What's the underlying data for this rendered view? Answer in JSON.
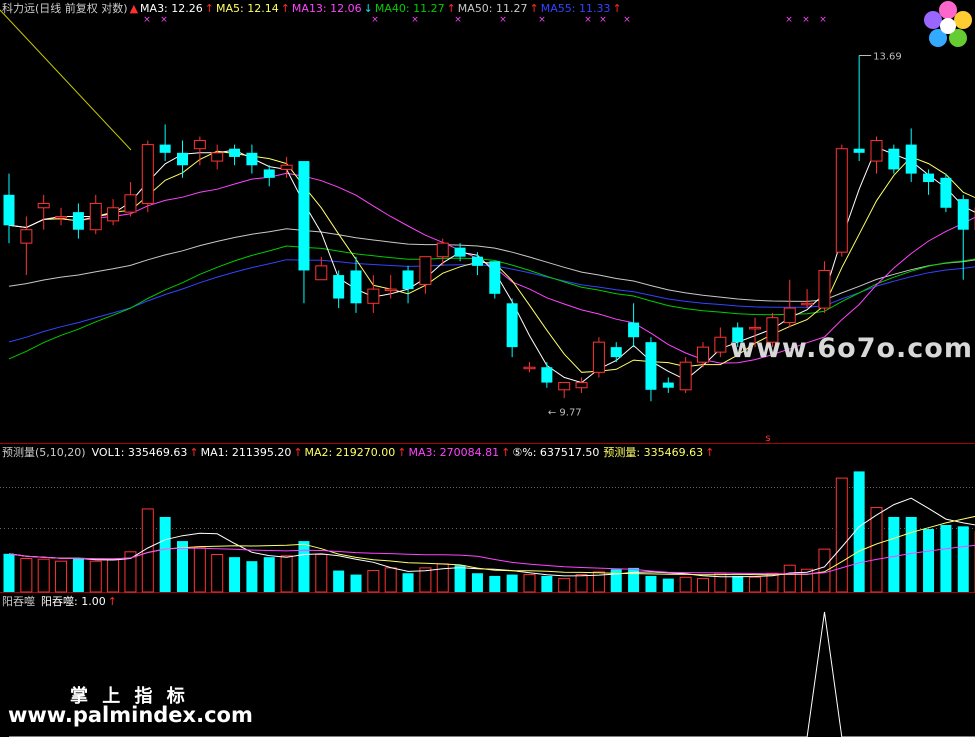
{
  "colors": {
    "up": "#ff3333",
    "down": "#00ffff",
    "ma3": "#ffffff",
    "ma5": "#ffff66",
    "ma13": "#ff44ff",
    "ma40": "#00cc00",
    "ma50": "#c8c8c8",
    "ma55": "#3344ff",
    "sep": "#aa0000",
    "signal": "#ffffff",
    "dotted": "#666666"
  },
  "price_header": {
    "title": "科力远(日线 前复权 对数)",
    "items": [
      {
        "label": "MA3: 12.26",
        "color": "#ffffff",
        "arrow": "↑",
        "dir": "up"
      },
      {
        "label": "MA5: 12.14",
        "color": "#ffff66",
        "arrow": "↑",
        "dir": "up"
      },
      {
        "label": "MA13: 12.06",
        "color": "#ff44ff",
        "arrow": "↓",
        "dir": "down"
      },
      {
        "label": "MA40: 11.27",
        "color": "#00cc00",
        "arrow": "↑",
        "dir": "up"
      },
      {
        "label": "MA50: 11.27",
        "color": "#c8c8c8",
        "arrow": "↑",
        "dir": "up"
      },
      {
        "label": "MA55: 11.33",
        "color": "#3344ff",
        "arrow": "↑",
        "dir": "up"
      }
    ]
  },
  "volume_header": {
    "title": "预测量(5,10,20)",
    "items": [
      {
        "label": "VOL1: 335469.63",
        "color": "#ffffff",
        "arrow": "↑"
      },
      {
        "label": "MA1: 211395.20",
        "color": "#ffffff",
        "arrow": "↑"
      },
      {
        "label": "MA2: 219270.00",
        "color": "#ffff66",
        "arrow": "↑"
      },
      {
        "label": "MA3: 270084.81",
        "color": "#ff44ff",
        "arrow": "↑"
      },
      {
        "label": "⑤%: 637517.50",
        "color": "#ffffff",
        "arrow": ""
      },
      {
        "label": "预测量: 335469.63",
        "color": "#ffff66",
        "arrow": "↑"
      }
    ]
  },
  "signal_header": {
    "title": "阳吞噬",
    "item": "阳吞噬: 1.00",
    "arrow": "↑"
  },
  "annotations": {
    "high": "13.69",
    "low": "← 9.77",
    "marker": "s"
  },
  "watermarks": {
    "site1": "www.6o7o.com",
    "cn": "掌 上 指 标",
    "site2": "www.palmindex.com"
  },
  "icons": {
    "logo": "flower-logo-icon"
  },
  "chart_data": {
    "type": "candlestick",
    "price_ylim": [
      9.5,
      14.2
    ],
    "volume_ylim": [
      0,
      1000000
    ],
    "candles": [
      [
        11.95,
        11.6,
        12.2,
        11.4,
        285000
      ],
      [
        11.4,
        11.55,
        11.7,
        11.05,
        250000
      ],
      [
        11.8,
        11.85,
        11.95,
        11.55,
        245000
      ],
      [
        11.7,
        11.7,
        11.8,
        11.6,
        230000
      ],
      [
        11.75,
        11.55,
        11.85,
        11.45,
        250000
      ],
      [
        11.55,
        11.85,
        11.95,
        11.5,
        230000
      ],
      [
        11.65,
        11.8,
        11.9,
        11.6,
        240000
      ],
      [
        11.75,
        11.95,
        12.1,
        11.7,
        300000
      ],
      [
        11.85,
        12.55,
        12.6,
        11.75,
        620000
      ],
      [
        12.55,
        12.45,
        12.8,
        12.35,
        560000
      ],
      [
        12.45,
        12.3,
        12.6,
        12.15,
        380000
      ],
      [
        12.5,
        12.6,
        12.65,
        12.3,
        330000
      ],
      [
        12.35,
        12.45,
        12.55,
        12.25,
        280000
      ],
      [
        12.5,
        12.4,
        12.55,
        12.3,
        260000
      ],
      [
        12.45,
        12.3,
        12.55,
        12.2,
        230000
      ],
      [
        12.25,
        12.15,
        12.3,
        12.05,
        260000
      ],
      [
        12.25,
        12.3,
        12.4,
        12.15,
        270000
      ],
      [
        12.35,
        11.1,
        12.35,
        10.75,
        380000
      ],
      [
        11.0,
        11.15,
        11.25,
        11.0,
        280000
      ],
      [
        11.05,
        10.8,
        11.1,
        10.7,
        160000
      ],
      [
        11.1,
        10.75,
        11.25,
        10.65,
        130000
      ],
      [
        10.75,
        10.9,
        11.05,
        10.65,
        160000
      ],
      [
        10.9,
        10.9,
        11.05,
        10.8,
        180000
      ],
      [
        11.1,
        10.9,
        11.15,
        10.75,
        140000
      ],
      [
        10.95,
        11.25,
        11.25,
        10.85,
        180000
      ],
      [
        11.25,
        11.4,
        11.45,
        11.15,
        210000
      ],
      [
        11.35,
        11.25,
        11.4,
        11.2,
        200000
      ],
      [
        11.25,
        11.15,
        11.3,
        11.05,
        140000
      ],
      [
        11.2,
        10.85,
        11.2,
        10.8,
        120000
      ],
      [
        10.75,
        10.3,
        10.8,
        10.2,
        130000
      ],
      [
        10.1,
        10.1,
        10.15,
        10.05,
        130000
      ],
      [
        10.1,
        9.95,
        10.15,
        9.9,
        120000
      ],
      [
        9.88,
        9.95,
        9.95,
        9.8,
        100000
      ],
      [
        9.9,
        9.95,
        10.0,
        9.85,
        130000
      ],
      [
        10.05,
        10.35,
        10.4,
        10.0,
        150000
      ],
      [
        10.3,
        10.2,
        10.35,
        10.15,
        170000
      ],
      [
        10.55,
        10.4,
        10.75,
        10.3,
        180000
      ],
      [
        10.35,
        9.88,
        10.4,
        9.77,
        120000
      ],
      [
        9.95,
        9.9,
        10.0,
        9.85,
        100000
      ],
      [
        9.88,
        10.15,
        10.2,
        9.85,
        110000
      ],
      [
        10.15,
        10.3,
        10.35,
        10.1,
        100000
      ],
      [
        10.25,
        10.4,
        10.5,
        10.2,
        140000
      ],
      [
        10.5,
        10.35,
        10.55,
        10.3,
        120000
      ],
      [
        10.5,
        10.5,
        10.6,
        10.3,
        110000
      ],
      [
        10.35,
        10.6,
        10.65,
        10.3,
        140000
      ],
      [
        10.55,
        10.7,
        11.0,
        10.5,
        200000
      ],
      [
        10.75,
        10.75,
        10.9,
        10.7,
        170000
      ],
      [
        10.7,
        11.1,
        11.2,
        10.65,
        320000
      ],
      [
        11.3,
        12.5,
        12.55,
        11.25,
        850000
      ],
      [
        12.5,
        12.45,
        13.69,
        12.35,
        900000
      ],
      [
        12.35,
        12.6,
        12.65,
        12.2,
        630000
      ],
      [
        12.5,
        12.25,
        12.55,
        12.2,
        560000
      ],
      [
        12.55,
        12.2,
        12.75,
        12.1,
        560000
      ],
      [
        12.2,
        12.1,
        12.25,
        11.95,
        470000
      ],
      [
        12.15,
        11.8,
        12.2,
        11.75,
        500000
      ],
      [
        11.9,
        11.55,
        11.95,
        11.0,
        490000
      ],
      [
        11.55,
        11.8,
        11.85,
        11.5,
        450000
      ],
      [
        11.85,
        12.0,
        12.05,
        11.8,
        450000
      ]
    ],
    "series": [
      {
        "name": "MA3"
      },
      {
        "name": "MA5"
      },
      {
        "name": "MA13"
      },
      {
        "name": "MA40"
      },
      {
        "name": "MA50"
      },
      {
        "name": "MA55"
      },
      {
        "name": "VOL MA1"
      },
      {
        "name": "VOL MA2"
      },
      {
        "name": "VOL MA3"
      }
    ],
    "signal": {
      "name": "阳吞噬",
      "values": [
        0,
        0,
        0,
        0,
        0,
        0,
        0,
        0,
        0,
        0,
        0,
        0,
        0,
        0,
        0,
        0,
        0,
        0,
        0,
        0,
        0,
        0,
        0,
        0,
        0,
        0,
        0,
        0,
        0,
        0,
        0,
        0,
        0,
        0,
        0,
        0,
        0,
        0,
        0,
        0,
        0,
        0,
        0,
        0,
        0,
        0,
        0,
        1,
        0,
        0,
        0,
        0,
        0,
        0,
        0,
        0,
        0,
        0
      ],
      "ylim": [
        0,
        1
      ]
    }
  }
}
